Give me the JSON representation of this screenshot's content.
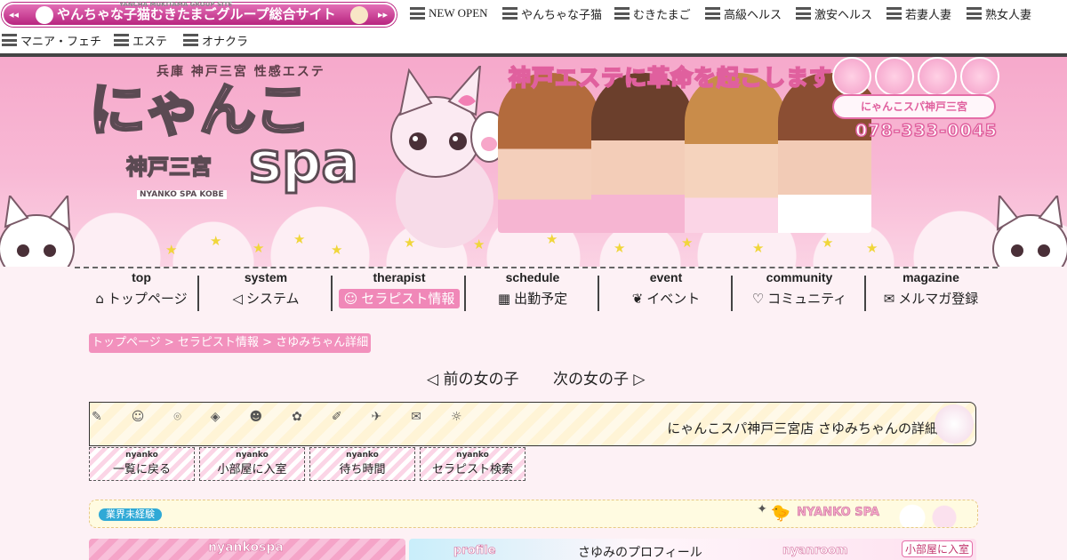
{
  "group_nav": {
    "arrows_left": "◂◂",
    "arrows_right": "▸▸",
    "group_site_label": "やんちゃな子猫むきたまごグループ総合サイト",
    "tiny_label": "YANCHA MUKITAMA GROUP SITE",
    "items": [
      {
        "label": "NEW OPEN"
      },
      {
        "label": "やんちゃな子猫"
      },
      {
        "label": "むきたまご"
      },
      {
        "label": "高級ヘルス"
      },
      {
        "label": "激安ヘルス"
      },
      {
        "label": "若妻人妻"
      },
      {
        "label": "熟女人妻"
      },
      {
        "label": "マニア・フェチ"
      },
      {
        "label": "エステ"
      },
      {
        "label": "オナクラ"
      }
    ]
  },
  "header": {
    "subtitle": "兵庫 神戸三宮 性感エステ",
    "logo_main": "にゃんこ",
    "logo_city": "神戸三宮",
    "logo_spa": "spa",
    "logo_en": "NYANKO SPA KOBE",
    "tagline": "神戸エステに革命を起こします!",
    "shop_tag": "にゃんこスパ神戸三宮",
    "phone": "078-333-0045"
  },
  "main_nav": [
    {
      "en": "top",
      "jp": "トップページ",
      "icon": "home-icon"
    },
    {
      "en": "system",
      "jp": "システム",
      "icon": "speaker-icon"
    },
    {
      "en": "therapist",
      "jp": "セラピスト情報",
      "icon": "smile-icon",
      "active": true
    },
    {
      "en": "schedule",
      "jp": "出勤予定",
      "icon": "calendar-icon"
    },
    {
      "en": "event",
      "jp": "イベント",
      "icon": "leaf-icon"
    },
    {
      "en": "community",
      "jp": "コミュニティ",
      "icon": "heart-icon"
    },
    {
      "en": "magazine",
      "jp": "メルマガ登録",
      "icon": "mail-icon"
    }
  ],
  "breadcrumb": {
    "home": "トップページ",
    "sep1": " > ",
    "therapist": "セラピスト情報",
    "sep2": " > ",
    "current": "さゆみちゃん詳細"
  },
  "pager": {
    "prev": "前の女の子",
    "next": "次の女の子"
  },
  "detail": {
    "icons": "✎☺⌾◈☻✿✐✈✉☼",
    "title": "にゃんこスパ神戸三宮店 さゆみちゃんの詳細"
  },
  "sub_buttons": [
    {
      "en": "nyanko",
      "jp": "一覧に戻る"
    },
    {
      "en": "nyanko",
      "jp": "小部屋に入室"
    },
    {
      "en": "nyanko",
      "jp": "待ち時間"
    },
    {
      "en": "nyanko",
      "jp": "セラピスト検索"
    }
  ],
  "experience": {
    "badge": "業界未経験",
    "brand": "NYANKO SPA",
    "sparkle": "✦",
    "chick": "🐤"
  },
  "profile_strip": {
    "left": "nyankospa",
    "profile_en": "profile",
    "profile_jp": "さゆみのプロフィール",
    "room_en": "nyanroom",
    "room_jp": "小部屋に入室"
  },
  "colors": {
    "accent_pink": "#f088b8",
    "banner_pink": "#f6a9cb",
    "badge_blue": "#2fa9d6",
    "group_link": "#b8257f"
  }
}
